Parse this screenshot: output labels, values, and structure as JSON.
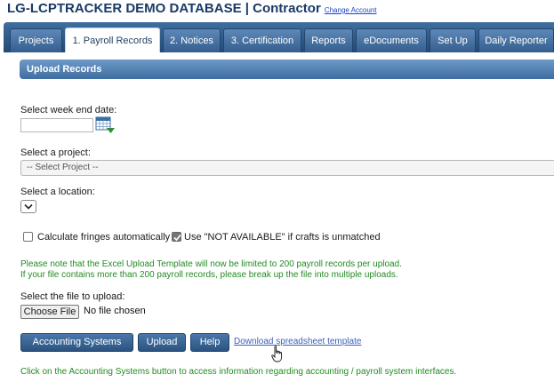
{
  "header": {
    "title": "LG-LCPTRACKER DEMO DATABASE | Contractor",
    "change_account": "Change Account"
  },
  "tabs": [
    {
      "label": "Projects"
    },
    {
      "label": "1. Payroll Records",
      "active": true
    },
    {
      "label": "2. Notices"
    },
    {
      "label": "3. Certification"
    },
    {
      "label": "Reports"
    },
    {
      "label": "eDocuments"
    },
    {
      "label": "Set Up"
    },
    {
      "label": "Daily Reporter"
    }
  ],
  "section": {
    "title": "Upload Records"
  },
  "form": {
    "week_end_label": "Select week end date:",
    "week_end_value": "",
    "project_label": "Select a project:",
    "project_selected": "-- Select Project --",
    "location_label": "Select a location:",
    "location_selected": "",
    "fringes_label": "Calculate fringes automatically",
    "fringes_checked": false,
    "not_available_label": "Use \"NOT AVAILABLE\" if crafts is unmatched",
    "not_available_checked": true,
    "note_line1": "Please note that the Excel Upload Template will now be limited to 200 payroll records per upload.",
    "note_line2": "If your file contains more than 200 payroll records, please break up the file into multiple uploads.",
    "file_label": "Select the file to upload:",
    "file_button": "Choose File",
    "file_status": "No file chosen"
  },
  "actions": {
    "accounting": "Accounting Systems",
    "upload": "Upload",
    "help": "Help",
    "download_link": "Download spreadsheet template"
  },
  "footer_note": "Click on the Accounting Systems button to access information regarding accounting / payroll system interfaces.",
  "colors": {
    "nav_blue": "#2f5a88",
    "note_green": "#228b22",
    "link_blue": "#3b5fb8"
  },
  "icons": {
    "calendar": "calendar-icon",
    "dropdown": "chevron-down-icon",
    "check": "check-icon",
    "cursor": "hand-pointer-icon"
  }
}
